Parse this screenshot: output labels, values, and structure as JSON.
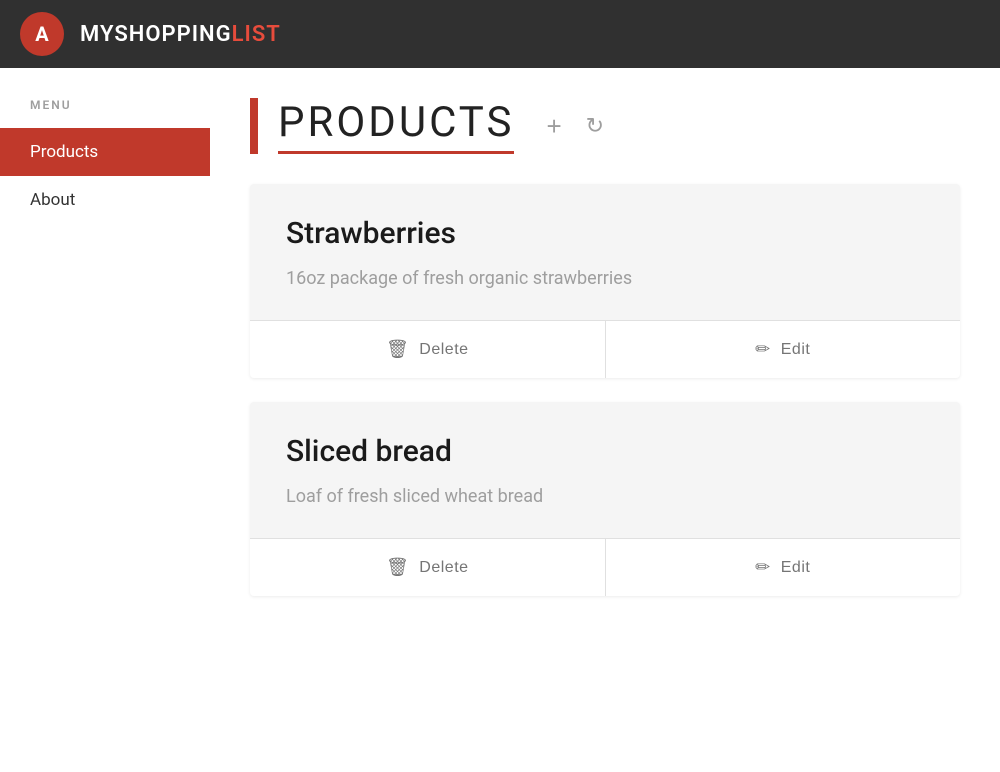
{
  "app": {
    "title_my": "MY",
    "title_shopping": "SHOPPING",
    "title_list": "LIST",
    "logo_letter": "A"
  },
  "sidebar": {
    "menu_label": "MENU",
    "items": [
      {
        "id": "products",
        "label": "Products",
        "active": true
      },
      {
        "id": "about",
        "label": "About",
        "active": false
      }
    ]
  },
  "main": {
    "page_title": "PRODUCTS",
    "add_button_label": "+",
    "refresh_button_label": "↻",
    "products": [
      {
        "id": 1,
        "name": "Strawberries",
        "description": "16oz package of fresh organic strawberries",
        "delete_label": "Delete",
        "edit_label": "Edit"
      },
      {
        "id": 2,
        "name": "Sliced bread",
        "description": "Loaf of fresh sliced wheat bread",
        "delete_label": "Delete",
        "edit_label": "Edit"
      }
    ]
  },
  "colors": {
    "primary": "#c0392b",
    "header_bg": "#303030",
    "sidebar_active_bg": "#c0392b",
    "card_bg": "#f5f5f5"
  }
}
